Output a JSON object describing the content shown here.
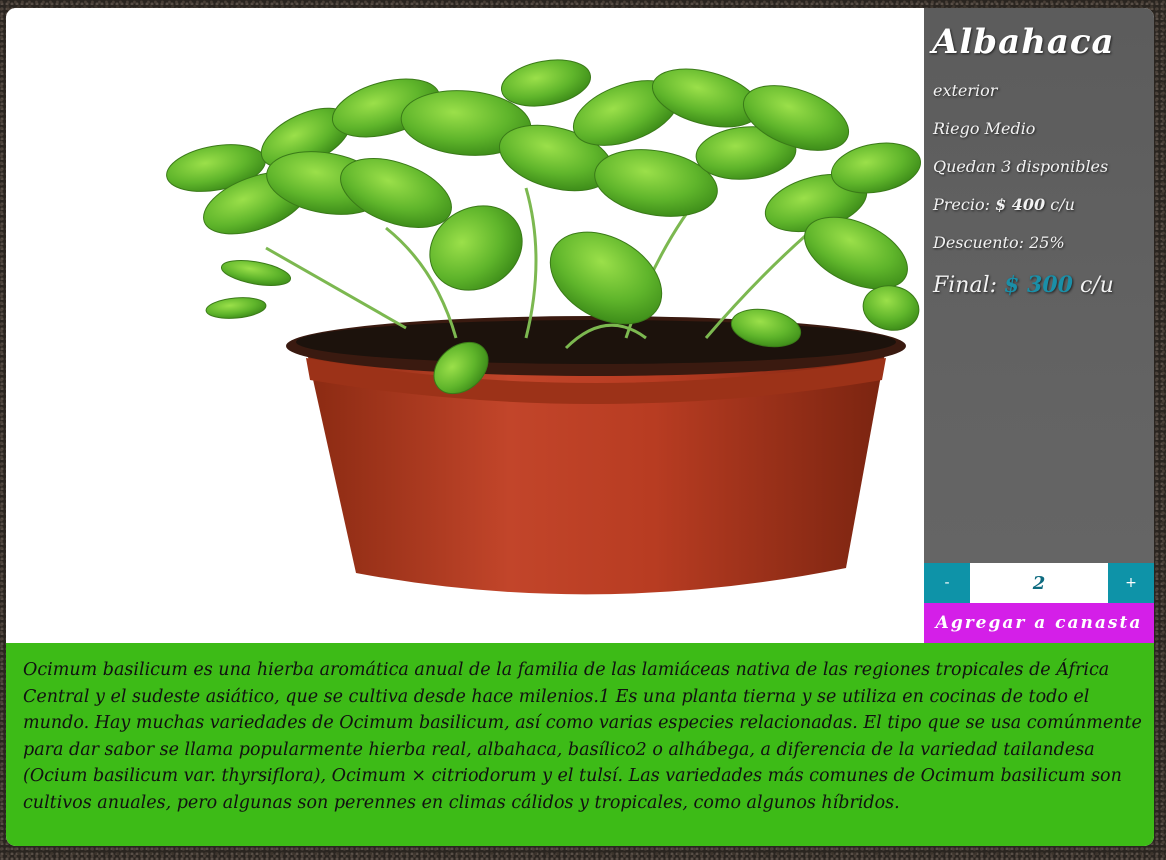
{
  "product": {
    "name": "Albahaca",
    "location": "exterior",
    "watering": "Riego Medio",
    "stock_text": "Quedan 3 disponibles",
    "price_label": "Precio:",
    "price_value": "$ 400",
    "price_unit": "c/u",
    "discount_text": "Descuento: 25%",
    "final_label": "Final:",
    "final_value": "$ 300",
    "final_unit": "c/u"
  },
  "cart": {
    "minus_label": "-",
    "quantity": "2",
    "plus_label": "+",
    "add_label": "Agregar a canasta"
  },
  "description": "Ocimum basilicum es una hierba aromática anual de la familia de las lamiáceas nativa de las regiones tropicales de África Central y el sudeste asiático, que se cultiva desde hace milenios.1 Es una planta tierna y se utiliza en cocinas de todo el mundo. Hay muchas variedades de Ocimum basilicum, así como varias especies relacionadas. El tipo que se usa comúnmente para dar sabor se llama popularmente hierba real, albahaca, basílico2 o alhábega, a diferencia de la variedad tailandesa (Ocium basilicum var. thyrsiflora), Ocimum × citriodorum y el tulsí. Las variedades más comunes de Ocimum basilicum son cultivos anuales, pero algunas son perennes en climas cálidos y tropicales, como algunos híbridos.",
  "colors": {
    "accent_teal": "#0e93a8",
    "add_button": "#d41fe8",
    "description_bg": "#3dbb17",
    "sidebar_bg": "#5f5f5f"
  }
}
